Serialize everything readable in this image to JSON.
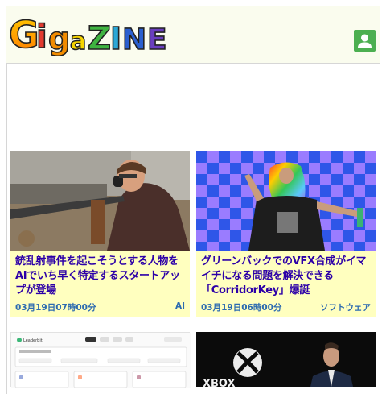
{
  "site": {
    "logo_text": "GigaZINE",
    "user_icon": "user-icon"
  },
  "articles": [
    {
      "title": "銃乱射事件を起こそうとする人物をAIでいち早く特定するスタートアップが登場",
      "date": "03月19日07時00分",
      "category": "AI"
    },
    {
      "title": "グリーンバックでのVFX合成がイマイチになる問題を解決できる「CorridorKey」爆誕",
      "date": "03月19日06時00分",
      "category": "ソフトウェア"
    }
  ],
  "bottom_cards": [
    {
      "logo_text": "Leaderbit"
    },
    {
      "logo_text": "XBOX"
    }
  ],
  "colors": {
    "header_bg": "#fafcee",
    "card_bg": "#ffffbf",
    "title_color": "#2c00a8",
    "meta_color": "#2d6bb0",
    "user_btn": "#4caf50"
  }
}
